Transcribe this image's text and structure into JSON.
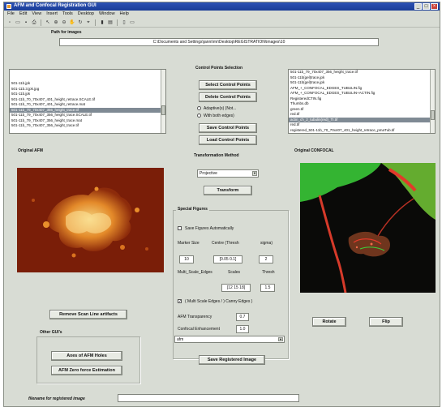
{
  "window": {
    "title": "AFM and Confocal Registration GUI"
  },
  "menu": [
    "File",
    "Edit",
    "View",
    "Insert",
    "Tools",
    "Desktop",
    "Window",
    "Help"
  ],
  "toolbar_icons": [
    "new-file-icon",
    "open-folder-icon",
    "save-icon",
    "print-icon",
    "pointer-icon",
    "zoom-in-icon",
    "zoom-out-icon",
    "pan-icon",
    "rotate-icon",
    "data-cursor-icon",
    "colorbar-icon",
    "legend-icon",
    "hide-plot-tools-icon",
    "show-plot-tools-icon"
  ],
  "path": {
    "label": "Path for images",
    "value": "C:\\Documents and Settings\\janni\\mr\\Desktop\\REGISTRATION\\images\\10"
  },
  "left_list": {
    "items": [
      "501-11b.jpk",
      "501-11b.3.jpk.jpg",
      "501-11b.jpk",
      "501-11b_70_70x407_401_height_retrace.SCALE.tif",
      "501-11b_70_70x407_401_height_retrace.mat",
      "501-11b_79_70x407_356_height_trace.tif",
      "501-11b_79_70x407_356_height_trace.SCALE.tif",
      "501-11b_79_70x407_356_height_trace.mat",
      "501-11b_79_70x407_356_height_trace.tif"
    ],
    "selected_index": 5
  },
  "right_list": {
    "items": [
      "501-11b_79_70x407_356_height_trace.tif",
      "501-11b(gel)trace.jpk",
      "501-11b(gel)trace.jpk",
      "AFM_+_CONFOCAL_EDGES_TUBULIN.fig",
      "AFM_+_CONFOCAL_EDGES_TUBULIN+ACTIN.fig",
      "RegisteredCTIN.fig",
      "Thumbs.db",
      "green.tif",
      "red.tif",
      "actin_ch_2_tubulin(red)_TI.tif",
      "red.tif",
      "registered_501-11b_70_70x407_401_height_retrace_pmaTub.tif"
    ],
    "selected_index": 9
  },
  "control_points": {
    "section_label": "Control Points Selection",
    "select_label": "Select Control Points",
    "delete_label": "Delete Control Points",
    "radio_adaptive": "Adaptive(s) (Not...",
    "radio_with_edges": "With both edges)",
    "save_label": "Save Control Points",
    "load_label": "Load Control Points"
  },
  "transformation": {
    "section_label": "Transformation Method",
    "method": "Projective",
    "transform_label": "Transform"
  },
  "special_figures": {
    "section_label": "Special Figures",
    "save_figures_label": "Save Figures Automatically",
    "marker_size_label": "Marker Size",
    "centre_label": "Centre (Thresh",
    "sigma_label": "sigma)",
    "marker_size": "10",
    "centre_thresh": "[0.05 0.1]",
    "sigma": "2",
    "multi_scale_label": "Multi_Scale_Edges",
    "scales_label": "Scales",
    "thresh_label": "Thresh",
    "scales": "[12 15 18]",
    "thresh": "1.5",
    "multi_scale_check_label": "( Multi Scale Edges / ) Canny Edges )",
    "afm_transparency_label": "AFM Transparency",
    "afm_transparency": "0.7",
    "confocal_enhancement_label": "Confocal Enhancement",
    "confocal_enhancement": "1.0",
    "overlay_select": "afm"
  },
  "save_registered_label": "Save Registered Image",
  "original_afm_label": "Original AFM",
  "original_confocal_label": "Original CONFOCAL",
  "remove_scan_label": "Remove Scan Line artifacts",
  "other_guis_label": "Other GUI's",
  "axes_afm_label": "Axes of AFM Holes",
  "afm_zero_force_label": "AFM Zero force Estimation",
  "rotate_label": "Rotate",
  "flip_label": "Flip",
  "filename_label": "filename for registered image",
  "filename_value": "",
  "colors": {
    "titlebar": "#1a3c96",
    "window_bg": "#d8dcd4",
    "afm_bg": "#7a1e08",
    "afm_feature": "#f2b14a",
    "confocal_bg": "#0a0a08",
    "confocal_green": "#3cd23a",
    "confocal_red": "#e23a2a"
  }
}
